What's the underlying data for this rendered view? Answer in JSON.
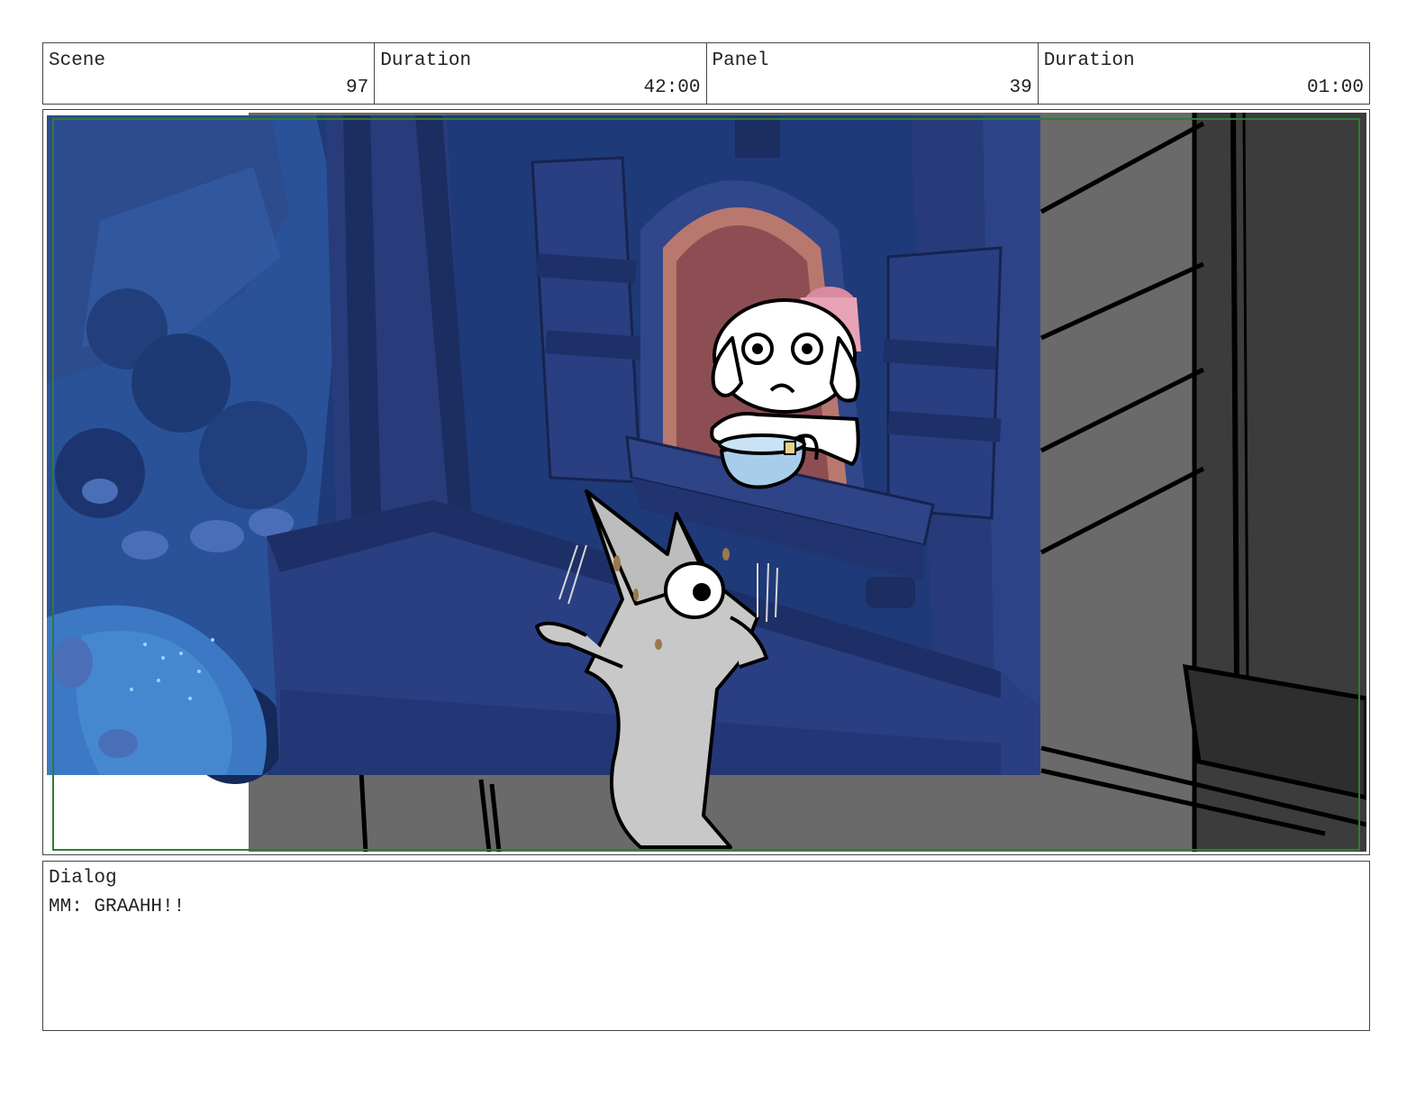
{
  "header": {
    "scene_label": "Scene",
    "scene_value": "97",
    "scene_duration_label": "Duration",
    "scene_duration_value": "42:00",
    "panel_label": "Panel",
    "panel_value": "39",
    "panel_duration_label": "Duration",
    "panel_duration_value": "01:00"
  },
  "panel": {
    "colors": {
      "night_sky": "#1f3a78",
      "tower_wood": "#2b3f82",
      "gray_block": "#6a6a6a",
      "dark_wall": "#3c3c3c",
      "safe_frame": "#2e7d32",
      "window_glow": "#d98aa0"
    }
  },
  "dialog": {
    "label": "Dialog",
    "text": "MM: GRAAHH!!"
  }
}
